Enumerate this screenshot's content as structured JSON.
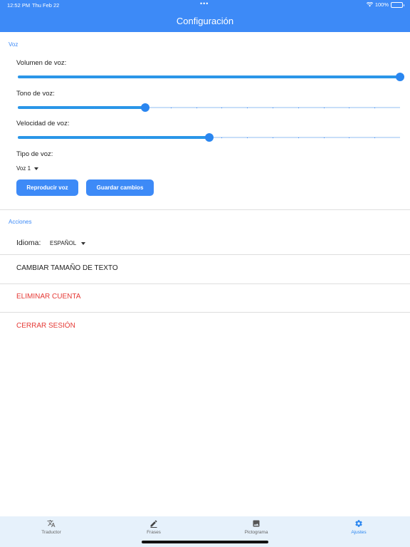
{
  "status_bar": {
    "time": "12:52 PM",
    "date": "Thu Feb 22",
    "battery": "100%"
  },
  "header": {
    "title": "Configuración"
  },
  "voz": {
    "section_label": "Voz",
    "volumen": {
      "label": "Volumen de voz:",
      "value": 1.0
    },
    "tono": {
      "label": "Tono de voz:",
      "value": 0.333
    },
    "velocidad": {
      "label": "Velocidad de voz:",
      "value": 0.5
    },
    "tipo": {
      "label": "Tipo de voz:",
      "selected": "Voz 1"
    },
    "reproducir_label": "Reproducir voz",
    "guardar_label": "Guardar cambios"
  },
  "acciones": {
    "section_label": "Acciones",
    "idioma_label": "Idioma:",
    "idioma_value": "ESPAÑOL",
    "cambiar_tamano": "CAMBIAR TAMAÑO DE TEXTO",
    "eliminar_cuenta": "ELIMINAR CUENTA",
    "cerrar_sesion": "CERRAR SESIÓN"
  },
  "colors": {
    "accent": "#3d8af7",
    "danger": "#e53935"
  },
  "tabs": [
    {
      "label": "Traductor",
      "icon": "translate-icon",
      "active": false
    },
    {
      "label": "Frases",
      "icon": "pencil-icon",
      "active": false
    },
    {
      "label": "Pictograma",
      "icon": "image-icon",
      "active": false
    },
    {
      "label": "Ajustes",
      "icon": "gear-icon",
      "active": true
    }
  ]
}
